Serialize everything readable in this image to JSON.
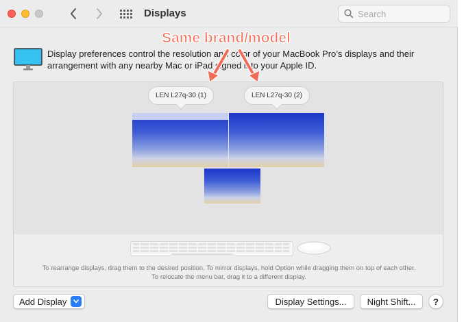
{
  "window": {
    "title": "Displays",
    "search_placeholder": "Search"
  },
  "description": "Display preferences control the resolution and color of your MacBook Pro’s displays and their arrangement with any nearby Mac or iPad signed into your Apple ID.",
  "displays": [
    {
      "label": "LEN L27q-30 (1)"
    },
    {
      "label": "LEN L27q-30 (2)"
    }
  ],
  "annotation": {
    "text": "Same brand/model",
    "color": "#f26b56"
  },
  "arrangement_hint": "To rearrange displays, drag them to the desired position. To mirror displays, hold Option while dragging them on top of each other. To relocate the menu bar, drag it to a different display.",
  "buttons": {
    "add_display": "Add Display",
    "display_settings": "Display Settings...",
    "night_shift": "Night Shift...",
    "help": "?"
  },
  "icons": {
    "close": "close-dot",
    "minimize": "minimize-dot",
    "zoom": "zoom-dot",
    "back": "chevron-left",
    "forward": "chevron-right",
    "show_all": "grid",
    "search": "magnifier",
    "displays": "monitor",
    "keyboard": "keyboard",
    "mouse": "mouse"
  },
  "colors": {
    "accent": "#2a7cf6",
    "close": "#ff5f57",
    "minimize": "#febc2e"
  }
}
